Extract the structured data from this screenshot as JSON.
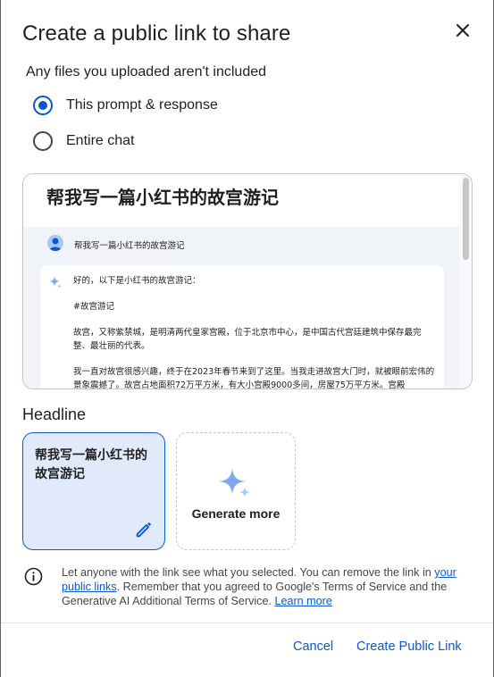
{
  "dialog": {
    "title": "Create a public link to share",
    "subtitle": "Any files you uploaded aren't included"
  },
  "options": [
    {
      "label": "This prompt & response",
      "checked": true
    },
    {
      "label": "Entire chat",
      "checked": false
    }
  ],
  "preview": {
    "title": "帮我写一篇小红书的故宫游记",
    "user_prompt": "帮我写一篇小红书的故宫游记",
    "response_lines": [
      "好的，以下是小红书的故宫游记：",
      "#故宫游记",
      "故宫，又称紫禁城，是明清两代皇家宫殿，位于北京市中心，是中国古代宫廷建筑中保存最完整、最壮丽的代表。",
      "我一直对故宫很感兴趣，终于在2023年春节来到了这里。当我走进故宫大门时，就被眼前宏伟的景象震撼了。故宫占地面积72万平方米，有大小宫殿9000多间，房屋75万平方米。宫殿"
    ]
  },
  "headline": {
    "label": "Headline",
    "text": "帮我写一篇小红书的故宫游记",
    "generate_label": "Generate more"
  },
  "notice": {
    "part1": "Let anyone with the link see what you selected. You can remove the link in ",
    "link1": "your public links",
    "part2": ". Remember that you agreed to Google's Terms of Service and the Generative AI Additional Terms of Service. ",
    "link2": "Learn more"
  },
  "footer": {
    "cancel_label": "Cancel",
    "create_label": "Create Public Link"
  },
  "colors": {
    "accent": "#0b57d0",
    "headline_bg": "#e1eafb",
    "preview_bg": "#f0f4f9"
  }
}
